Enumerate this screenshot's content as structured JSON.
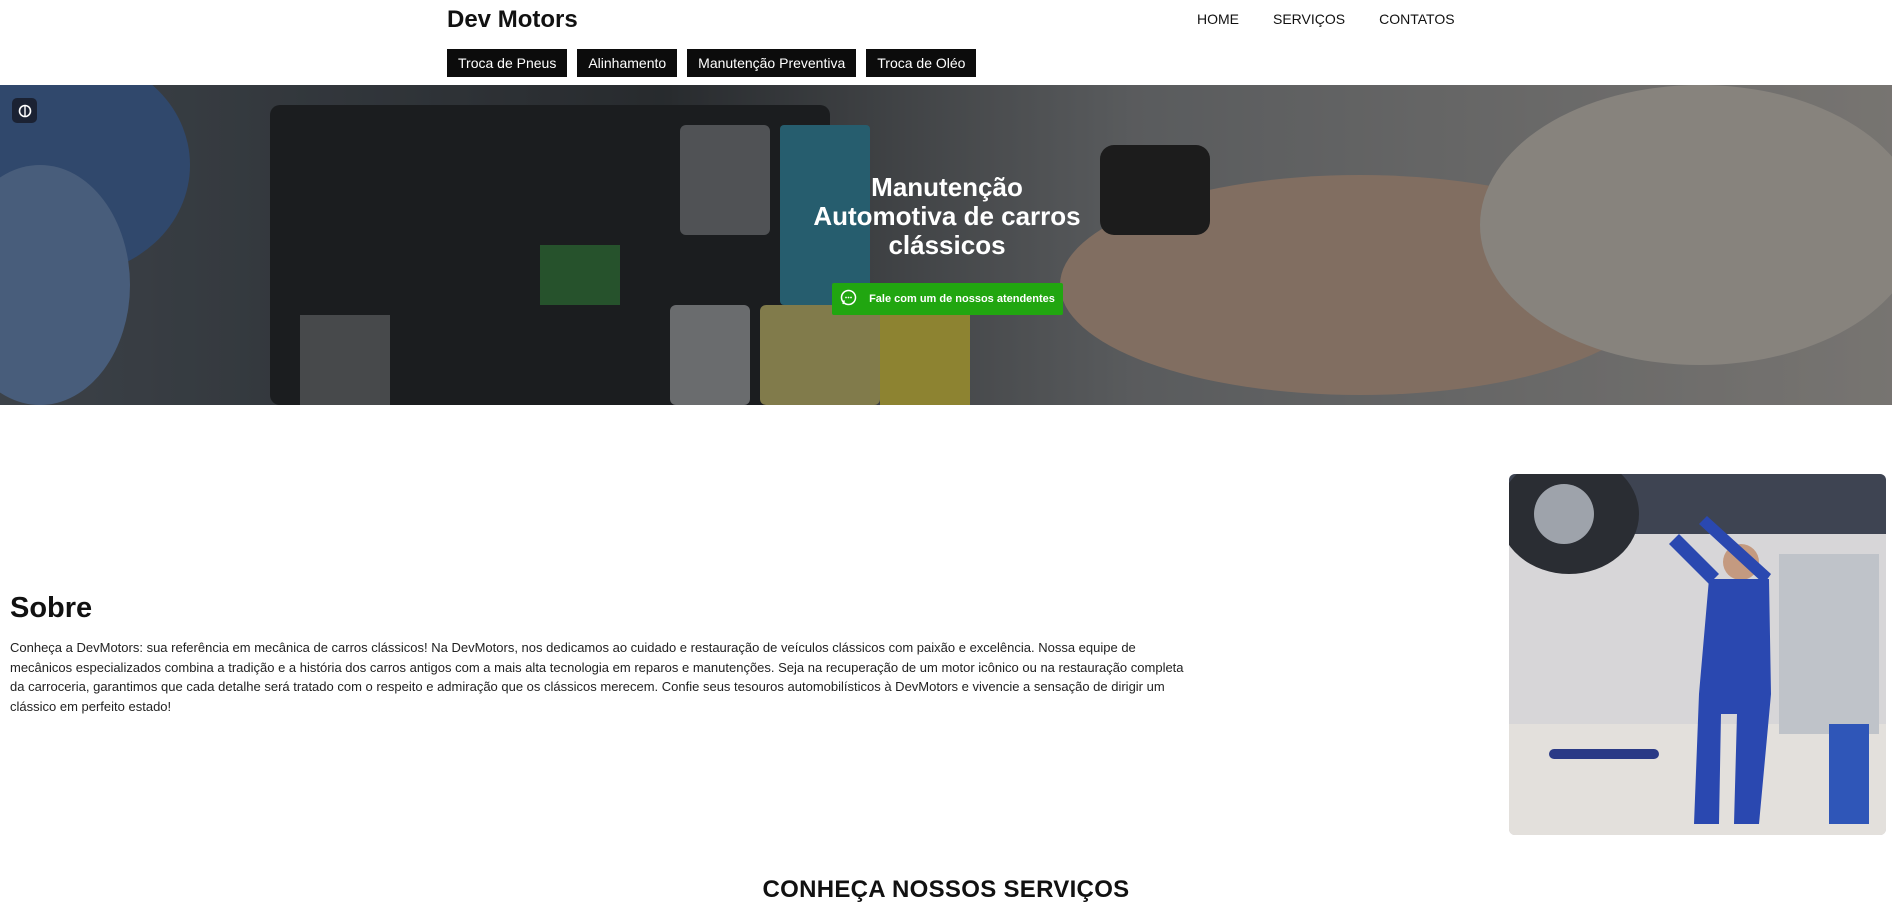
{
  "header": {
    "brand": "Dev Motors",
    "nav": [
      {
        "label": "HOME"
      },
      {
        "label": "SERVIÇOS"
      },
      {
        "label": "CONTATOS"
      }
    ],
    "service_chips": [
      {
        "label": "Troca de Pneus"
      },
      {
        "label": "Alinhamento"
      },
      {
        "label": "Manutenção Preventiva"
      },
      {
        "label": "Troca de Oléo"
      }
    ]
  },
  "hero": {
    "title": "Manutenção Automotiva de carros clássicos",
    "cta_label": "Fale com um de nossos atendentes",
    "cta_icon": "whatsapp-icon",
    "cta_color": "#21a610"
  },
  "about": {
    "title": "Sobre",
    "text": "Conheça a DevMotors: sua referência em mecânica de carros clássicos! Na DevMotors, nos dedicamos ao cuidado e restauração de veículos clássicos com paixão e excelência. Nossa equipe de mecânicos especializados combina a tradição e a história dos carros antigos com a mais alta tecnologia em reparos e manutenções. Seja na recuperação de um motor icônico ou na restauração completa da carroceria, garantimos que cada detalhe será tratado com o respeito e admiração que os clássicos merecem. Confie seus tesouros automobilísticos à DevMotors e vivencie a sensação de dirigir um clássico em perfeito estado!"
  },
  "services": {
    "title": "CONHEÇA NOSSOS SERVIÇOS"
  }
}
